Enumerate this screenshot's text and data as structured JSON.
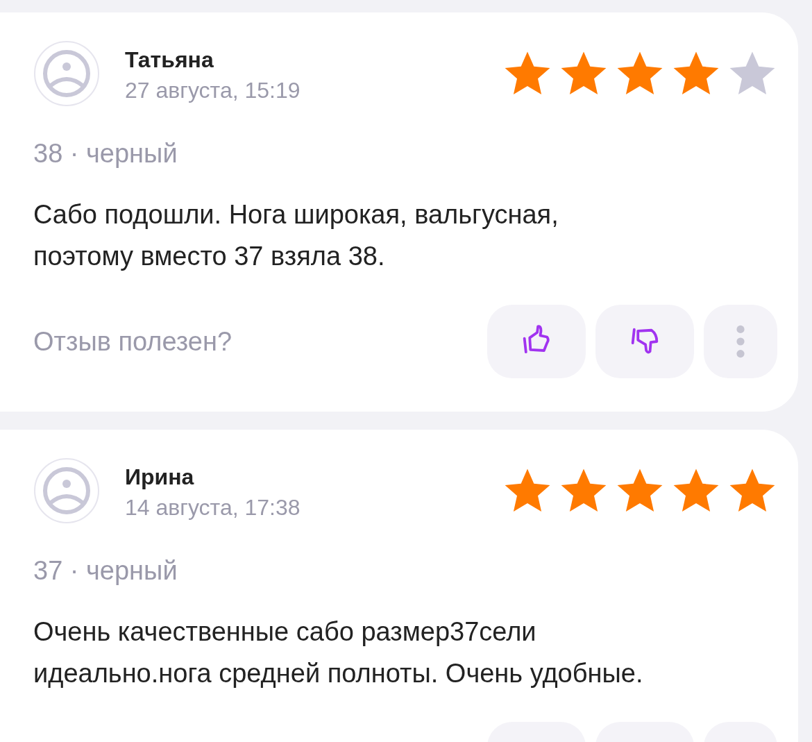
{
  "reviews": [
    {
      "author": "Татьяна",
      "date": "27 августа, 15:19",
      "stars": 4,
      "variant": "38 · черный",
      "text": "Сабо подошли. Нога широкая, вальгусная, поэтому вместо 37 взяла 38.",
      "helpful_prompt": "Отзыв полезен?"
    },
    {
      "author": "Ирина",
      "date": "14 августа, 17:38",
      "stars": 5,
      "variant": "37 · черный",
      "text": "Очень качественные сабо размер37сели идеально.нога средней полноты. Очень удобные."
    }
  ]
}
